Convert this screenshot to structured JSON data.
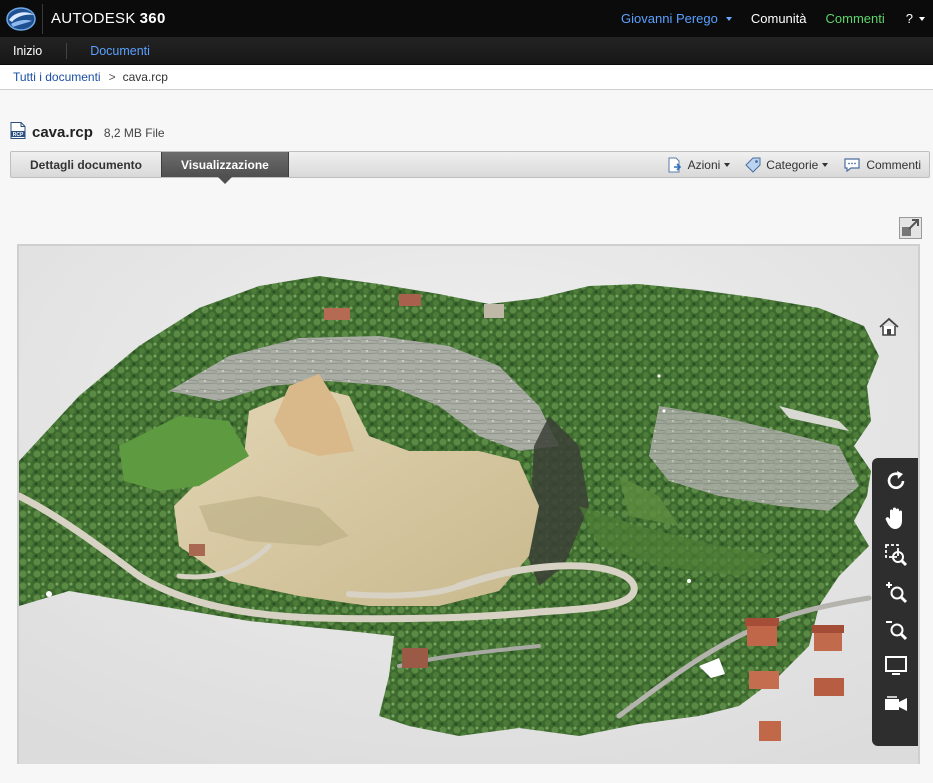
{
  "topbar": {
    "brand": "AUTODESK",
    "brand_suffix": "360",
    "user": "Giovanni Perego",
    "community": "Comunità",
    "comments": "Commenti",
    "help": "?"
  },
  "nav": {
    "home": "Inizio",
    "documents": "Documenti"
  },
  "breadcrumb": {
    "root": "Tutti i documenti",
    "separator": ">",
    "current": "cava.rcp"
  },
  "file": {
    "name": "cava.rcp",
    "meta": "8,2 MB File",
    "icon_label": "RCP"
  },
  "tabs": {
    "details": "Dettagli documento",
    "view": "Visualizzazione"
  },
  "actions": {
    "azioni": "Azioni",
    "categorie": "Categorie",
    "commenti": "Commenti"
  },
  "colors": {
    "topbar_bg": "#0b0b0b",
    "link_blue": "#5aa0ff",
    "comments_green": "#5ed46a",
    "active_tab": "#5b5b5b",
    "viewer_bg": "#e9e9e9"
  },
  "viewer_tools": [
    "orbit-icon",
    "pan-icon",
    "zoom-window-icon",
    "zoom-in-icon",
    "zoom-out-icon",
    "fit-screen-icon",
    "camera-icon"
  ]
}
